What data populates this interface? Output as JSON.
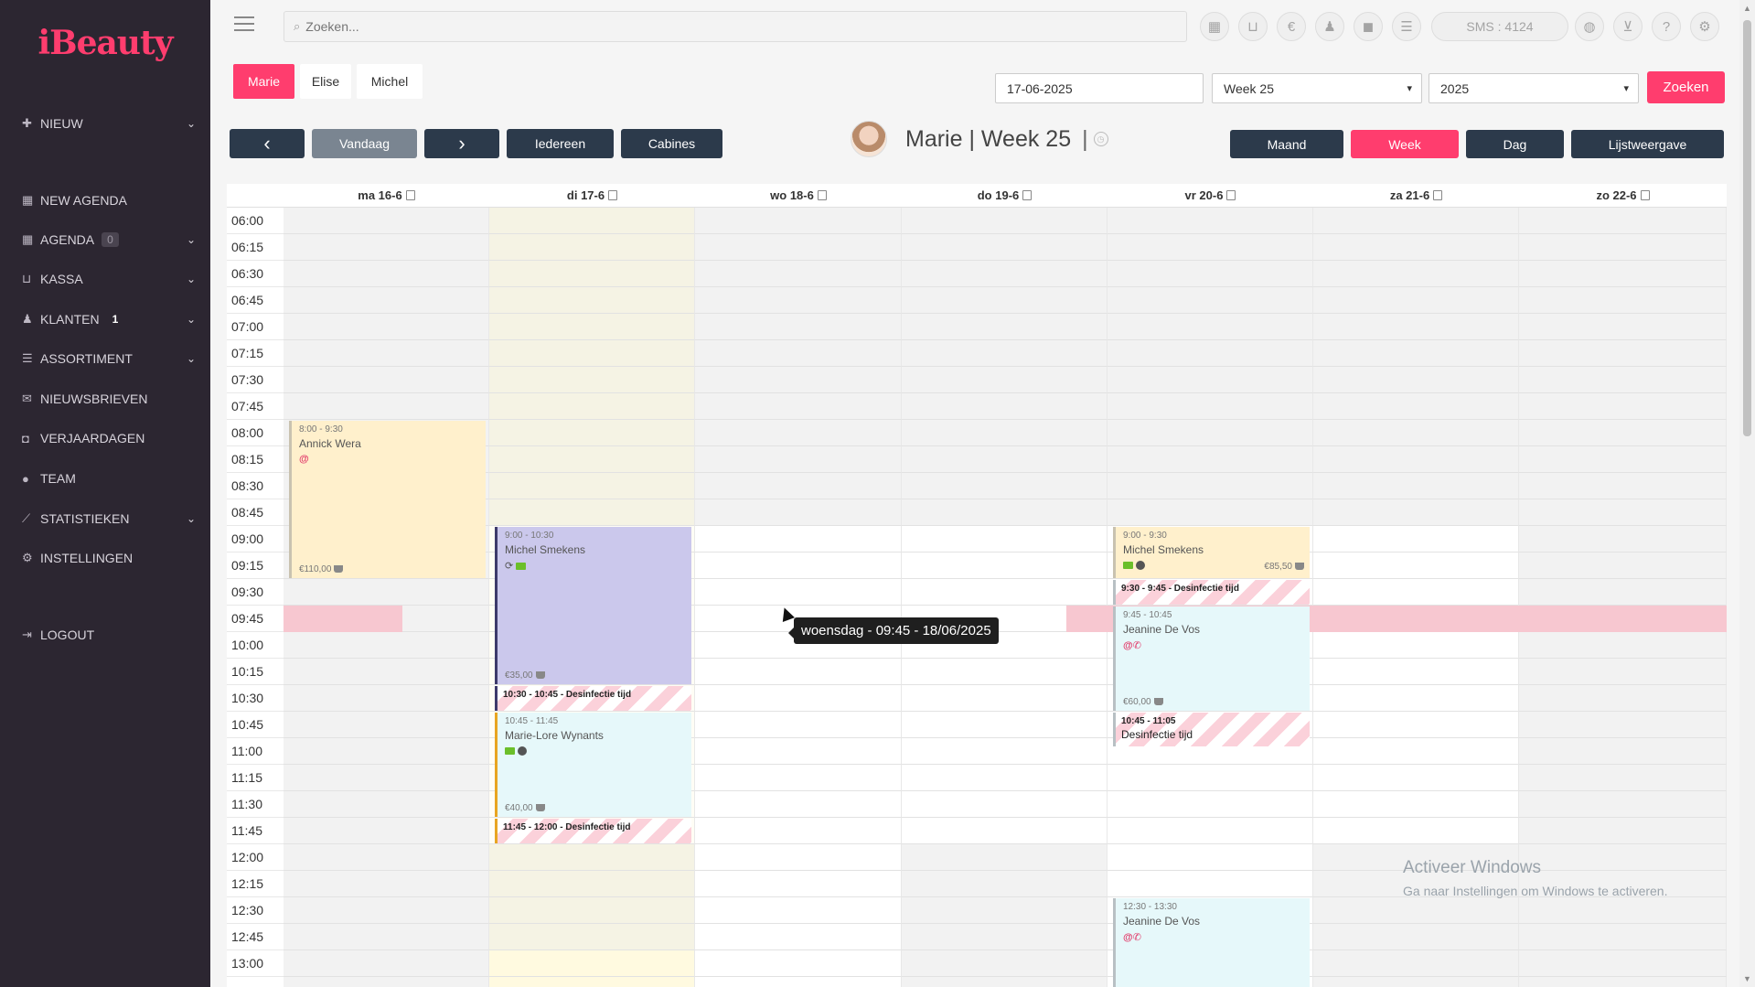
{
  "app": {
    "logo": "iBeauty"
  },
  "sidebar": {
    "items": [
      {
        "label": "NIEUW",
        "icon": "plus-icon",
        "badge": "",
        "has_chevron": true
      },
      {
        "label": "NEW AGENDA",
        "icon": "calendar-icon",
        "badge": "",
        "has_chevron": false
      },
      {
        "label": "AGENDA",
        "icon": "calendar-icon",
        "badge": "0",
        "has_chevron": true
      },
      {
        "label": "KASSA",
        "icon": "basket-icon",
        "badge": "",
        "has_chevron": true
      },
      {
        "label": "KLANTEN",
        "icon": "users-icon",
        "badge": "1",
        "has_chevron": true
      },
      {
        "label": "ASSORTIMENT",
        "icon": "list-icon",
        "badge": "",
        "has_chevron": true
      },
      {
        "label": "NIEUWSBRIEVEN",
        "icon": "envelope-icon",
        "badge": "",
        "has_chevron": false
      },
      {
        "label": "VERJAARDAGEN",
        "icon": "gift-icon",
        "badge": "",
        "has_chevron": false
      },
      {
        "label": "TEAM",
        "icon": "user-icon",
        "badge": "",
        "has_chevron": false
      },
      {
        "label": "STATISTIEKEN",
        "icon": "chart-icon",
        "badge": "",
        "has_chevron": true
      },
      {
        "label": "INSTELLINGEN",
        "icon": "cogs-icon",
        "badge": "",
        "has_chevron": false
      },
      {
        "label": "LOGOUT",
        "icon": "signout-icon",
        "badge": "",
        "has_chevron": false
      }
    ]
  },
  "topbar": {
    "search_placeholder": "Zoeken...",
    "icons": [
      "calendar-icon",
      "basket-icon",
      "euro-icon",
      "users-icon",
      "briefcase-icon",
      "list-icon"
    ],
    "sms_label": "SMS : 4124",
    "right_icons": [
      "globe-icon",
      "cart-icon",
      "help-icon",
      "gear-icon"
    ]
  },
  "employees": [
    {
      "label": "Marie",
      "active": true
    },
    {
      "label": "Elise",
      "active": false
    },
    {
      "label": "Michel",
      "active": false
    }
  ],
  "controls": {
    "date_value": "17-06-2025",
    "week_select": "Week 25",
    "year_select": "2025",
    "search_button": "Zoeken",
    "prev_label": "‹",
    "today_label": "Vandaag",
    "next_label": "›",
    "everyone_label": "Iedereen",
    "cabins_label": "Cabines",
    "view_month": "Maand",
    "view_week": "Week",
    "view_day": "Dag",
    "view_list": "Lijstweergave"
  },
  "title": {
    "text": "Marie | Week 25",
    "separator": "|"
  },
  "calendar": {
    "days": [
      "ma 16-6",
      "di 17-6",
      "wo 18-6",
      "do 19-6",
      "vr 20-6",
      "za 21-6",
      "zo 22-6"
    ],
    "times": [
      "06:00",
      "06:15",
      "06:30",
      "06:45",
      "07:00",
      "07:15",
      "07:30",
      "07:45",
      "08:00",
      "08:15",
      "08:30",
      "08:45",
      "09:00",
      "09:15",
      "09:30",
      "09:45",
      "10:00",
      "10:15",
      "10:30",
      "10:45",
      "11:00",
      "11:15",
      "11:30",
      "11:45",
      "12:00",
      "12:15",
      "12:30",
      "12:45",
      "13:00"
    ],
    "appointments": [
      {
        "day": 0,
        "start": "08:00",
        "time": "8:00 - 9:30",
        "name": "Annick Wera",
        "icons": [
          "at-icon"
        ],
        "price": "€110,00"
      },
      {
        "day": 1,
        "start": "09:00",
        "time": "9:00 - 10:30",
        "name": "Michel Smekens",
        "icons": [
          "refresh-icon",
          "mail-icon"
        ],
        "price": "€35,00"
      },
      {
        "day": 1,
        "start": "10:45",
        "time": "10:45 - 11:45",
        "name": "Marie-Lore Wynants",
        "icons": [
          "mail-icon",
          "globe-icon"
        ],
        "price": "€40,00"
      },
      {
        "day": 4,
        "start": "09:00",
        "time": "9:00 - 9:30",
        "name": "Michel Smekens",
        "icons": [
          "mail-icon",
          "globe-icon"
        ],
        "price": "€85,50"
      },
      {
        "day": 4,
        "start": "09:45",
        "time": "9:45 - 10:45",
        "name": "Jeanine De Vos",
        "icons": [
          "at-icon",
          "phone-icon"
        ],
        "price": "€60,00"
      },
      {
        "day": 4,
        "start": "12:30",
        "time": "12:30 - 13:30",
        "name": "Jeanine De Vos",
        "icons": [
          "at-icon",
          "phone-icon"
        ],
        "price": ""
      }
    ],
    "disinfections": [
      {
        "day": 1,
        "label": "10:30 - 10:45 - Desinfectie tijd"
      },
      {
        "day": 1,
        "label": "11:45 - 12:00 - Desinfectie tijd"
      },
      {
        "day": 4,
        "label": "9:30 - 9:45 - Desinfectie tijd"
      },
      {
        "day": 4,
        "label": "10:45 - 11:05",
        "label2": "Desinfectie tijd"
      }
    ],
    "tooltip": "woensdag - 09:45 - 18/06/2025"
  },
  "windows_activation": {
    "title": "Activeer Windows",
    "subtitle": "Ga naar Instellingen om Windows te activeren."
  },
  "colors": {
    "accent": "#ff3d6e",
    "sidebar": "#2c2631",
    "dark_button": "#2c3a4b",
    "appt_yellow": "#fff0cc",
    "appt_purple": "#cbc8ec",
    "appt_cyan": "#e6f8fa",
    "highlight": "#f7c7d0"
  }
}
